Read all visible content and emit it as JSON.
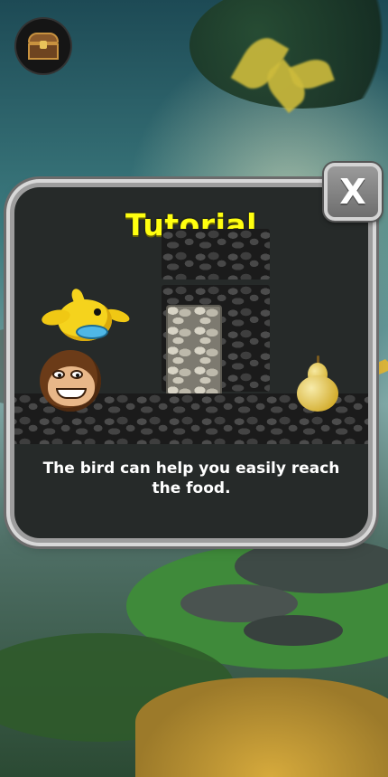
{
  "tutorial": {
    "title": "Tutorial",
    "message": "The bird can help you easily reach the food.",
    "close_label": "X"
  },
  "hud": {
    "treasure_icon": "treasure-chest-icon"
  },
  "colors": {
    "title": "#ffff10",
    "message": "#ffffff",
    "panel_bg": "#262a29",
    "panel_border": "#d8d8d8",
    "close_button": "#8a8a8a"
  }
}
